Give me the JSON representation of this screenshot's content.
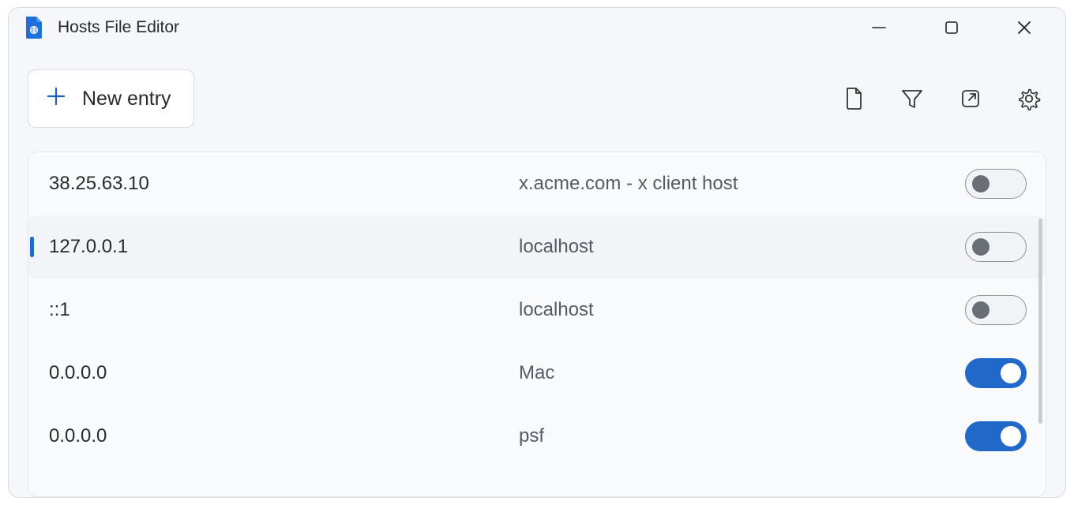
{
  "titlebar": {
    "title": "Hosts File Editor"
  },
  "toolbar": {
    "new_entry_label": "New entry"
  },
  "entries": [
    {
      "ip": "38.25.63.10",
      "host": "x.acme.com - x client host",
      "enabled": false,
      "selected": false
    },
    {
      "ip": "127.0.0.1",
      "host": "localhost",
      "enabled": false,
      "selected": true
    },
    {
      "ip": "::1",
      "host": "localhost",
      "enabled": false,
      "selected": false
    },
    {
      "ip": "0.0.0.0",
      "host": "Mac",
      "enabled": true,
      "selected": false
    },
    {
      "ip": "0.0.0.0",
      "host": "psf",
      "enabled": true,
      "selected": false
    }
  ],
  "colors": {
    "accent": "#2169c9"
  }
}
